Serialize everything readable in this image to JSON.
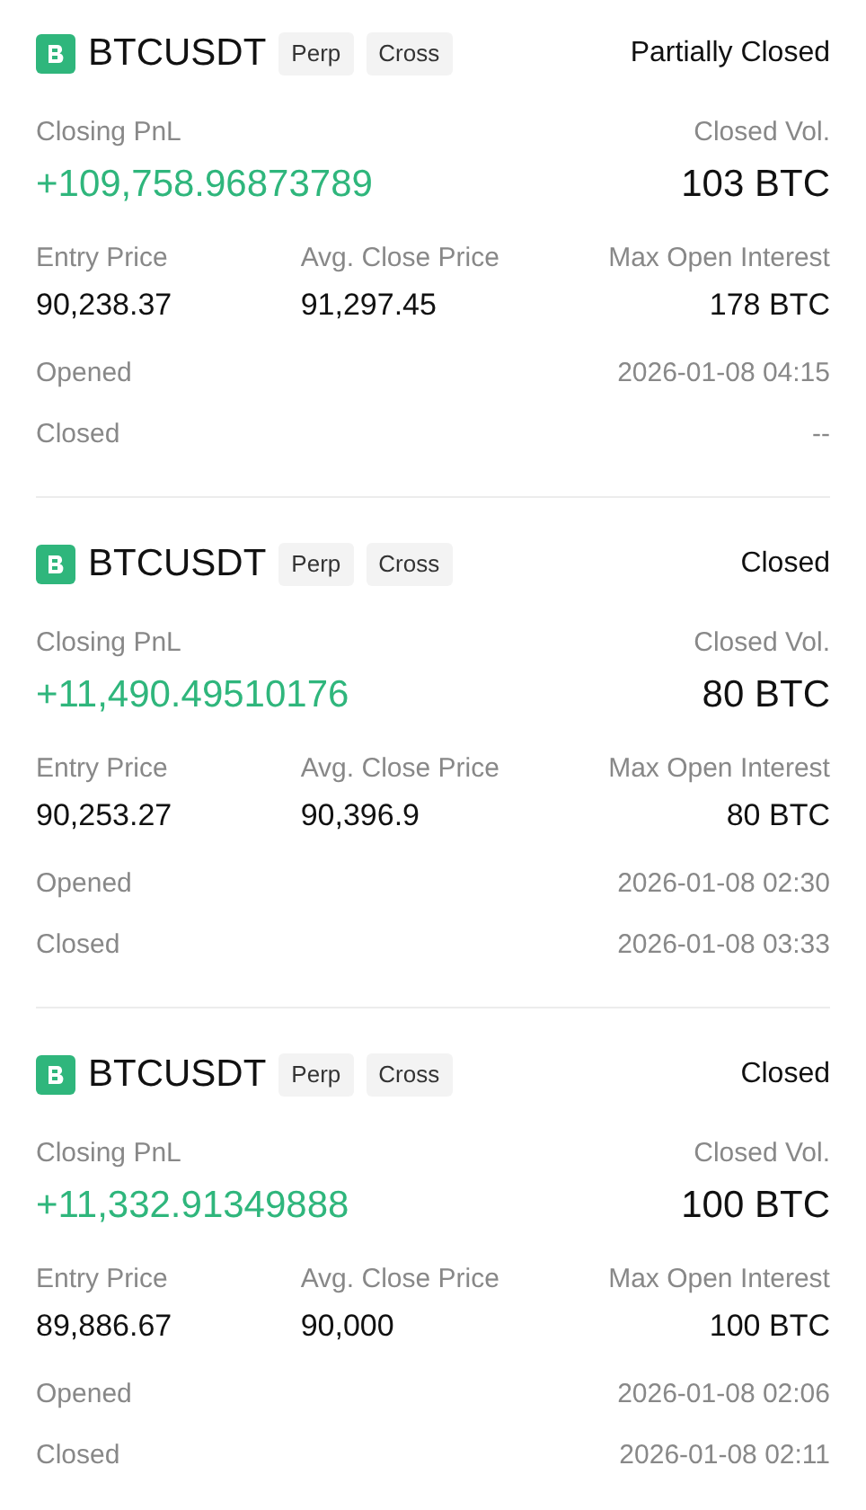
{
  "positions": [
    {
      "symbol": "BTCUSDT",
      "tags": [
        "Perp",
        "Cross"
      ],
      "status": "Partially Closed",
      "pnl_label": "Closing PnL",
      "pnl": "+109,758.96873789",
      "volume_label": "Closed Vol.",
      "volume": "103 BTC",
      "prices": [
        {
          "label": "Entry Price",
          "value": "90,238.37"
        },
        {
          "label": "Avg. Close Price",
          "value": "91,297.45"
        },
        {
          "label": "Max Open Interest",
          "value": "178 BTC"
        }
      ],
      "times": [
        {
          "label": "Opened",
          "value": "2026-01-08 04:15"
        },
        {
          "label": "Closed",
          "value": "--"
        }
      ]
    },
    {
      "symbol": "BTCUSDT",
      "tags": [
        "Perp",
        "Cross"
      ],
      "status": "Closed",
      "pnl_label": "Closing PnL",
      "pnl": "+11,490.49510176",
      "volume_label": "Closed Vol.",
      "volume": "80 BTC",
      "prices": [
        {
          "label": "Entry Price",
          "value": "90,253.27"
        },
        {
          "label": "Avg. Close Price",
          "value": "90,396.9"
        },
        {
          "label": "Max Open Interest",
          "value": "80 BTC"
        }
      ],
      "times": [
        {
          "label": "Opened",
          "value": "2026-01-08 02:30"
        },
        {
          "label": "Closed",
          "value": "2026-01-08 03:33"
        }
      ]
    },
    {
      "symbol": "BTCUSDT",
      "tags": [
        "Perp",
        "Cross"
      ],
      "status": "Closed",
      "pnl_label": "Closing PnL",
      "pnl": "+11,332.91349888",
      "volume_label": "Closed Vol.",
      "volume": "100 BTC",
      "prices": [
        {
          "label": "Entry Price",
          "value": "89,886.67"
        },
        {
          "label": "Avg. Close Price",
          "value": "90,000"
        },
        {
          "label": "Max Open Interest",
          "value": "100 BTC"
        }
      ],
      "times": [
        {
          "label": "Opened",
          "value": "2026-01-08 02:06"
        },
        {
          "label": "Closed",
          "value": "2026-01-08 02:11"
        }
      ]
    }
  ]
}
